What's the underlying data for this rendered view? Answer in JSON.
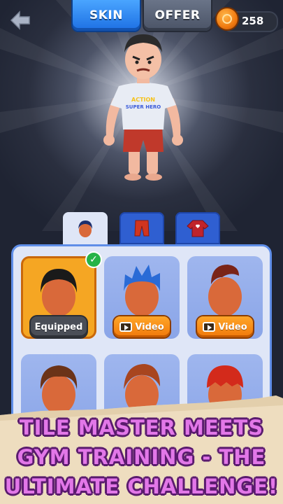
{
  "topbar": {
    "tabs": [
      {
        "label": "SKIN",
        "active": true
      },
      {
        "label": "OFFER",
        "active": false
      }
    ],
    "coins": "258",
    "accent": "#1c6fe3"
  },
  "character": {
    "shirt_text_line1": "ACTION",
    "shirt_text_line2": "SUPER HERO"
  },
  "categories": [
    {
      "icon": "hair-icon",
      "active": true
    },
    {
      "icon": "pants-icon",
      "active": false
    },
    {
      "icon": "shirt-icon",
      "active": false
    }
  ],
  "items": [
    {
      "hair": "black-short",
      "status": "Equipped",
      "selected": true
    },
    {
      "hair": "blue-spiky",
      "status": "Video",
      "selected": false
    },
    {
      "hair": "red-pompadour",
      "status": "Video",
      "selected": false
    },
    {
      "hair": "brown-messy",
      "status": "",
      "selected": false
    },
    {
      "hair": "auburn-swept",
      "status": "",
      "selected": false
    },
    {
      "hair": "red-flat",
      "status": "",
      "selected": false
    }
  ],
  "banner": {
    "line1": "TILE MASTER MEETS",
    "line2": "GYM TRAINING - THE",
    "line3": "ULTIMATE CHALLENGE!"
  }
}
